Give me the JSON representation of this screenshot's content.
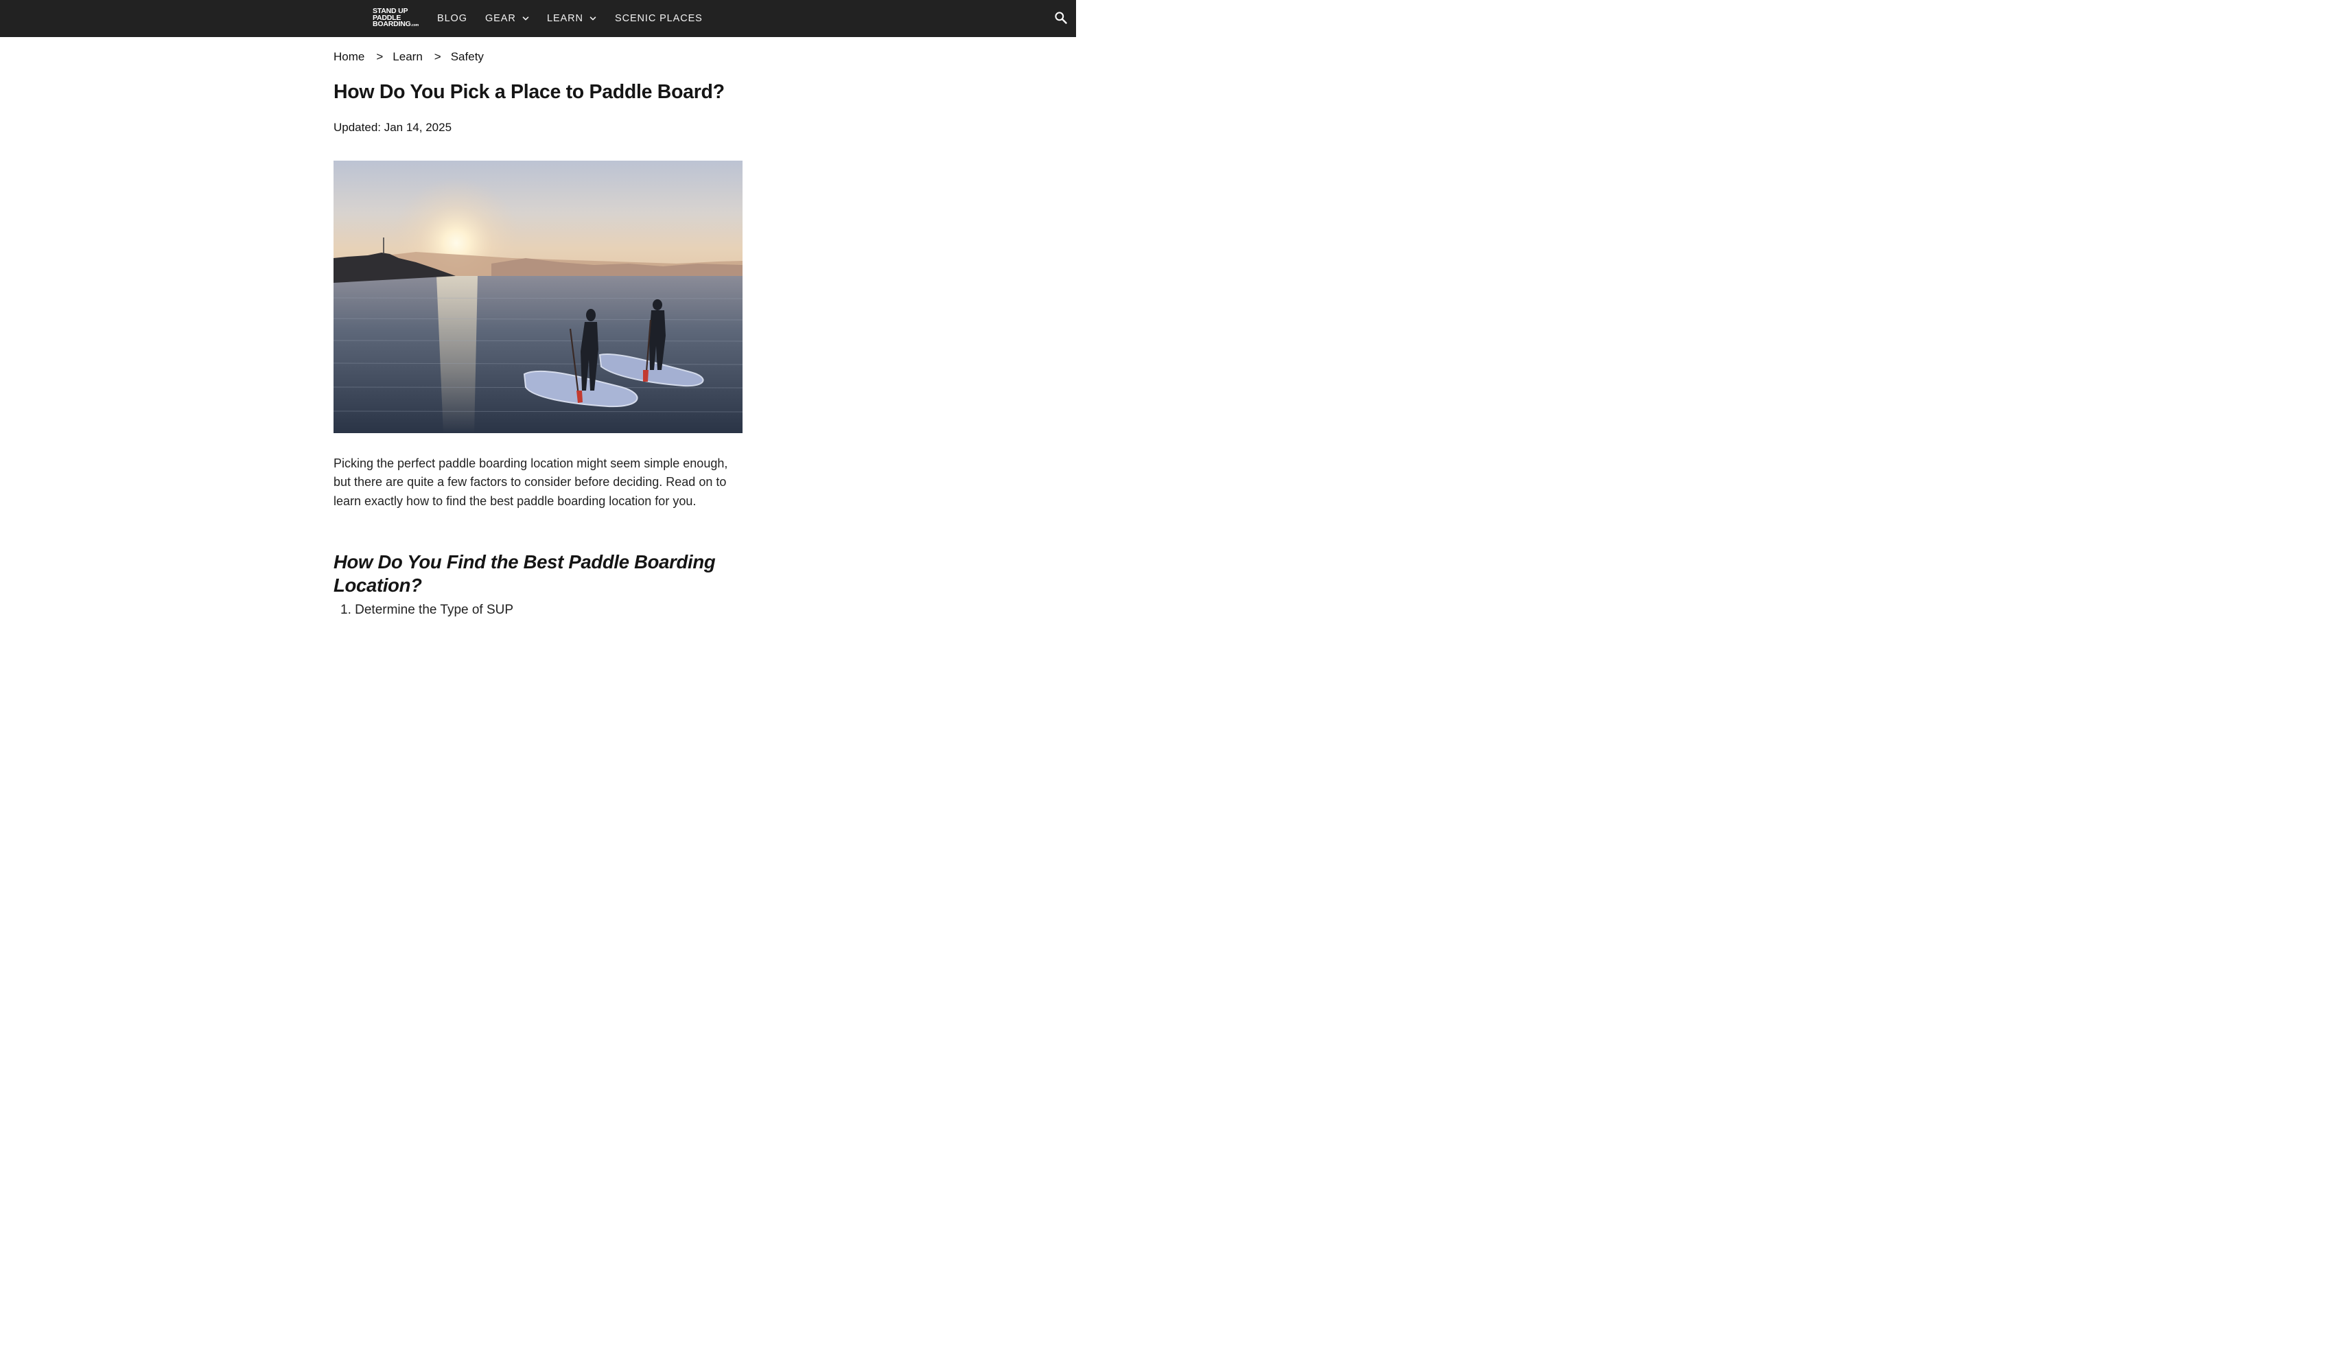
{
  "header": {
    "logo_lines": [
      "STAND UP",
      "PADDLE",
      "BOARDING"
    ],
    "logo_suffix": ".com",
    "nav": [
      {
        "label": "BLOG",
        "has_dropdown": false
      },
      {
        "label": "GEAR",
        "has_dropdown": true
      },
      {
        "label": "LEARN",
        "has_dropdown": true
      },
      {
        "label": "SCENIC PLACES",
        "has_dropdown": false
      }
    ],
    "search_icon": "search-icon",
    "background": "#222222"
  },
  "breadcrumb": {
    "items": [
      "Home",
      "Learn",
      "Safety"
    ],
    "separator": ">"
  },
  "article": {
    "title": "How Do You Pick a Place to Paddle Board?",
    "updated": "Updated: Jan 14, 2025",
    "intro": "Picking the perfect paddle boarding location might seem simple enough, but there are quite a few factors to consider before deciding. Read on to learn exactly how to find the best paddle boarding location for you.",
    "section_heading": "How Do You Find the Best Paddle Boarding Location?",
    "list": [
      "1. Determine the Type of SUP"
    ]
  }
}
